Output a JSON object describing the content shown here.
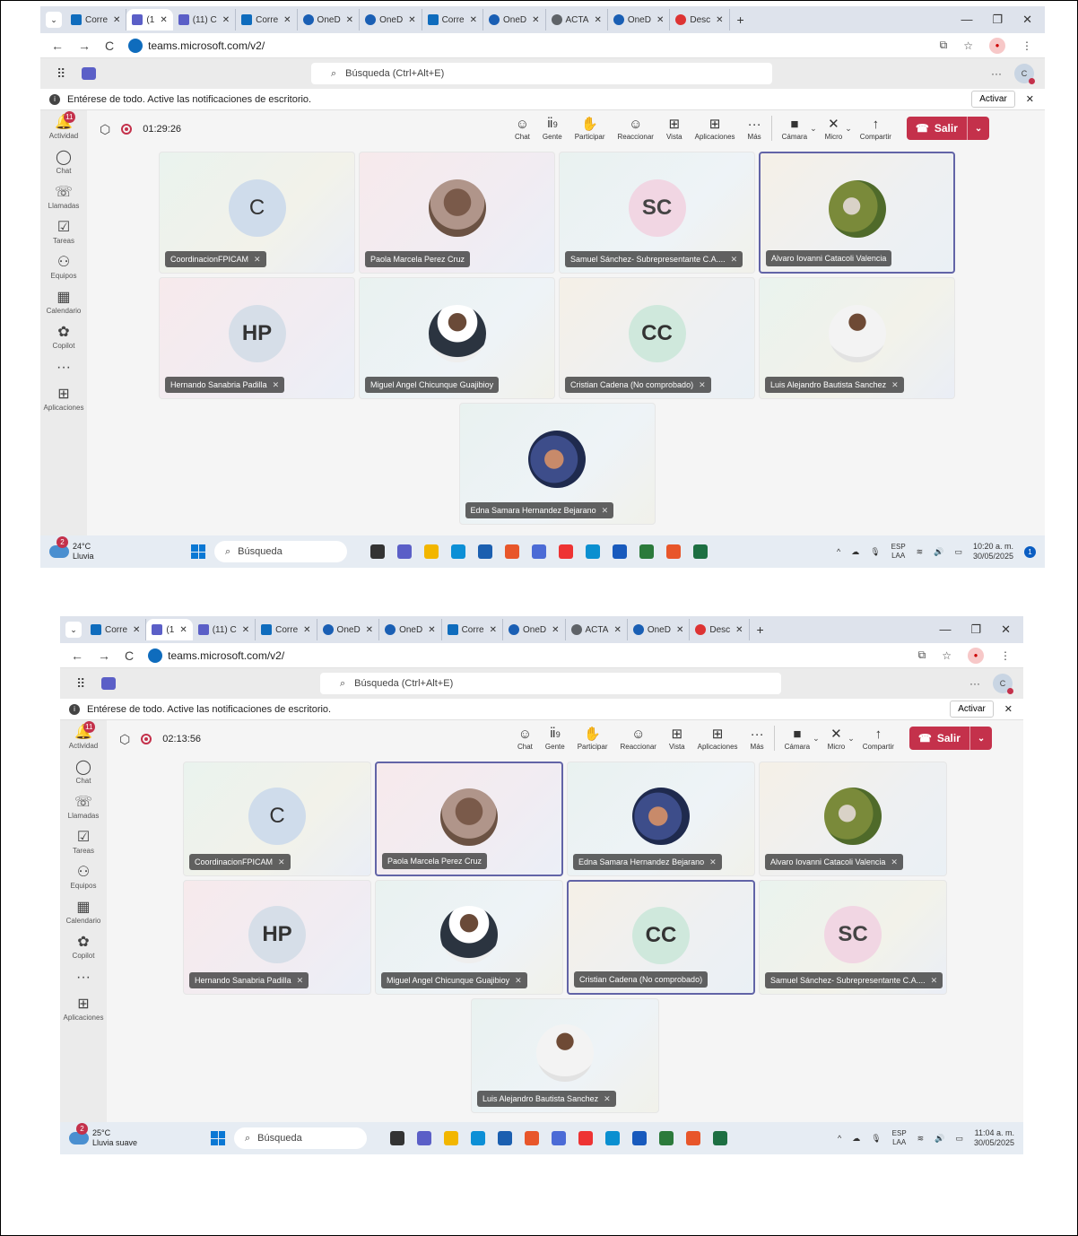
{
  "shots": [
    {
      "tabs": [
        {
          "label": "Corre",
          "icon": "outlook"
        },
        {
          "label": "(1",
          "icon": "teams",
          "active": true
        },
        {
          "label": "(11) C",
          "icon": "teams"
        },
        {
          "label": "Corre",
          "icon": "outlook"
        },
        {
          "label": "OneD",
          "icon": "onedrive"
        },
        {
          "label": "OneD",
          "icon": "onedrive"
        },
        {
          "label": "Corre",
          "icon": "outlook"
        },
        {
          "label": "OneD",
          "icon": "onedrive"
        },
        {
          "label": "ACTA",
          "icon": "chrome"
        },
        {
          "label": "OneD",
          "icon": "onedrive"
        },
        {
          "label": "Desc",
          "icon": "desc"
        }
      ],
      "url": "teams.microsoft.com/v2/",
      "search_placeholder": "Búsqueda (Ctrl+Alt+E)",
      "notification": "Entérese de todo. Active las notificaciones de escritorio.",
      "notification_button": "Activar",
      "rail": [
        {
          "label": "Actividad",
          "icon": "bell-icon",
          "badge": "11"
        },
        {
          "label": "Chat",
          "icon": "chat-icon"
        },
        {
          "label": "Llamadas",
          "icon": "phone-icon"
        },
        {
          "label": "Tareas",
          "icon": "tasks-icon"
        },
        {
          "label": "Equipos",
          "icon": "teams-icon"
        },
        {
          "label": "Calendario",
          "icon": "calendar-icon"
        },
        {
          "label": "Copilot",
          "icon": "copilot-icon"
        },
        {
          "label": "...",
          "icon": "more-icon"
        },
        {
          "label": "Aplicaciones",
          "icon": "apps-icon"
        }
      ],
      "timer": "01:29:26",
      "controls": [
        {
          "label": "Chat",
          "glyph": "☺"
        },
        {
          "label": "Gente",
          "glyph": "ⅱ",
          "count": "9"
        },
        {
          "label": "Participar",
          "glyph": "✋"
        },
        {
          "label": "Reaccionar",
          "glyph": "☺"
        },
        {
          "label": "Vista",
          "glyph": "⊞"
        },
        {
          "label": "Aplicaciones",
          "glyph": "⊞"
        },
        {
          "label": "Más",
          "glyph": "···"
        }
      ],
      "devices": [
        {
          "label": "Cámara",
          "glyph": "■"
        },
        {
          "label": "Micro",
          "glyph": "✕"
        },
        {
          "label": "Compartir",
          "glyph": "↑"
        }
      ],
      "leave_label": "Salir",
      "participants": [
        {
          "name": "CoordinacionFPICAM",
          "initials": "C",
          "style": "init-c",
          "muted": true
        },
        {
          "name": "Paola Marcela Perez Cruz",
          "initials": "",
          "style": "photo-paola",
          "muted": false
        },
        {
          "name": "Samuel Sánchez- Subrepresentante C.A....",
          "initials": "SC",
          "style": "init-sc",
          "muted": true
        },
        {
          "name": "Alvaro Iovanni Catacoli Valencia",
          "initials": "",
          "style": "photo-alvaro",
          "muted": false,
          "speaking": true
        },
        {
          "name": "Hernando Sanabria Padilla",
          "initials": "HP",
          "style": "init-hp",
          "muted": true
        },
        {
          "name": "Miguel Angel Chicunque Guajibioy",
          "initials": "",
          "style": "photo-miguel",
          "muted": false
        },
        {
          "name": "Cristian Cadena (No comprobado)",
          "initials": "CC",
          "style": "init-cc",
          "muted": true
        },
        {
          "name": "Luis Alejandro Bautista Sanchez",
          "initials": "",
          "style": "photo-luis",
          "muted": true
        },
        {
          "name": "Edna Samara Hernandez Bejarano",
          "initials": "",
          "style": "photo-edna",
          "muted": true
        }
      ],
      "weather": {
        "temp": "24°C",
        "desc": "Lluvia",
        "badge": "2"
      },
      "taskbar_search": "Búsqueda",
      "lang": {
        "top": "ESP",
        "bottom": "LAA"
      },
      "clock": {
        "time": "10:20 a. m.",
        "date": "30/05/2025"
      },
      "tray_badge": "1"
    },
    {
      "tabs": [
        {
          "label": "Corre",
          "icon": "outlook"
        },
        {
          "label": "(1",
          "icon": "teams",
          "active": true
        },
        {
          "label": "(11) C",
          "icon": "teams"
        },
        {
          "label": "Corre",
          "icon": "outlook"
        },
        {
          "label": "OneD",
          "icon": "onedrive"
        },
        {
          "label": "OneD",
          "icon": "onedrive"
        },
        {
          "label": "Corre",
          "icon": "outlook"
        },
        {
          "label": "OneD",
          "icon": "onedrive"
        },
        {
          "label": "ACTA",
          "icon": "chrome"
        },
        {
          "label": "OneD",
          "icon": "onedrive"
        },
        {
          "label": "Desc",
          "icon": "desc"
        }
      ],
      "url": "teams.microsoft.com/v2/",
      "search_placeholder": "Búsqueda (Ctrl+Alt+E)",
      "notification": "Entérese de todo. Active las notificaciones de escritorio.",
      "notification_button": "Activar",
      "rail": [
        {
          "label": "Actividad",
          "icon": "bell-icon",
          "badge": "11"
        },
        {
          "label": "Chat",
          "icon": "chat-icon"
        },
        {
          "label": "Llamadas",
          "icon": "phone-icon"
        },
        {
          "label": "Tareas",
          "icon": "tasks-icon"
        },
        {
          "label": "Equipos",
          "icon": "teams-icon"
        },
        {
          "label": "Calendario",
          "icon": "calendar-icon"
        },
        {
          "label": "Copilot",
          "icon": "copilot-icon"
        },
        {
          "label": "...",
          "icon": "more-icon"
        },
        {
          "label": "Aplicaciones",
          "icon": "apps-icon"
        }
      ],
      "timer": "02:13:56",
      "controls": [
        {
          "label": "Chat",
          "glyph": "☺"
        },
        {
          "label": "Gente",
          "glyph": "ⅱ",
          "count": "9"
        },
        {
          "label": "Participar",
          "glyph": "✋"
        },
        {
          "label": "Reaccionar",
          "glyph": "☺"
        },
        {
          "label": "Vista",
          "glyph": "⊞"
        },
        {
          "label": "Aplicaciones",
          "glyph": "⊞"
        },
        {
          "label": "Más",
          "glyph": "···"
        }
      ],
      "devices": [
        {
          "label": "Cámara",
          "glyph": "■"
        },
        {
          "label": "Micro",
          "glyph": "✕"
        },
        {
          "label": "Compartir",
          "glyph": "↑"
        }
      ],
      "leave_label": "Salir",
      "participants": [
        {
          "name": "CoordinacionFPICAM",
          "initials": "C",
          "style": "init-c",
          "muted": true
        },
        {
          "name": "Paola Marcela Perez Cruz",
          "initials": "",
          "style": "photo-paola",
          "muted": false,
          "speaking": true
        },
        {
          "name": "Edna Samara Hernandez Bejarano",
          "initials": "",
          "style": "photo-edna",
          "muted": true
        },
        {
          "name": "Alvaro Iovanni Catacoli Valencia",
          "initials": "",
          "style": "photo-alvaro",
          "muted": true
        },
        {
          "name": "Hernando Sanabria Padilla",
          "initials": "HP",
          "style": "init-hp",
          "muted": true
        },
        {
          "name": "Miguel Angel Chicunque Guajibioy",
          "initials": "",
          "style": "photo-miguel",
          "muted": true
        },
        {
          "name": "Cristian Cadena (No comprobado)",
          "initials": "CC",
          "style": "init-cc",
          "muted": false,
          "speaking": true
        },
        {
          "name": "Samuel Sánchez- Subrepresentante C.A....",
          "initials": "SC",
          "style": "init-sc",
          "muted": true
        },
        {
          "name": "Luis Alejandro Bautista Sanchez",
          "initials": "",
          "style": "photo-luis",
          "muted": true
        }
      ],
      "weather": {
        "temp": "25°C",
        "desc": "Lluvia suave",
        "badge": "2"
      },
      "taskbar_search": "Búsqueda",
      "lang": {
        "top": "ESP",
        "bottom": "LAA"
      },
      "clock": {
        "time": "11:04 a. m.",
        "date": "30/05/2025"
      },
      "tray_badge": ""
    }
  ]
}
